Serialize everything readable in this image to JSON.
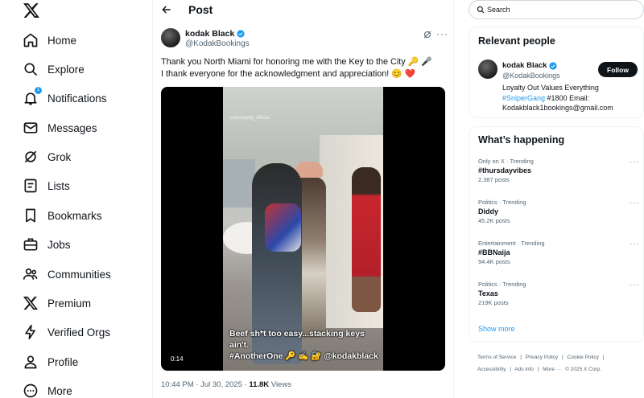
{
  "nav": {
    "items": [
      {
        "label": "Home",
        "icon": "home-icon"
      },
      {
        "label": "Explore",
        "icon": "search-icon"
      },
      {
        "label": "Notifications",
        "icon": "bell-icon",
        "badge": "1"
      },
      {
        "label": "Messages",
        "icon": "mail-icon"
      },
      {
        "label": "Grok",
        "icon": "grok-icon"
      },
      {
        "label": "Lists",
        "icon": "list-icon"
      },
      {
        "label": "Bookmarks",
        "icon": "bookmark-icon"
      },
      {
        "label": "Jobs",
        "icon": "briefcase-icon"
      },
      {
        "label": "Communities",
        "icon": "people-icon"
      },
      {
        "label": "Premium",
        "icon": "x-logo-icon"
      },
      {
        "label": "Verified Orgs",
        "icon": "lightning-icon"
      },
      {
        "label": "Profile",
        "icon": "person-icon"
      },
      {
        "label": "More",
        "icon": "more-circle-icon"
      }
    ]
  },
  "header": {
    "title": "Post"
  },
  "tweet": {
    "author_name": "kodak Black",
    "author_handle": "@KodakBookings",
    "text_line1": "Thank you North Miami for honoring me with the Key to the City 🔑 🎤",
    "text_line2": "I thank everyone  for the acknowledgment and appreciation! 😊 ❤️",
    "video": {
      "watermark": "snipergang_official",
      "caption_line1": "Beef sh*t too easy...stacking keys ain't.",
      "caption_line2": "#AnotherOne 🔑 ✍️ 🔐 @kodakblack",
      "duration": "0:14"
    },
    "time": "10:44 PM · Jul 30, 2025 · ",
    "views_count": "11.8K",
    "views_label": " Views"
  },
  "search": {
    "placeholder": "Search"
  },
  "relevant": {
    "title": "Relevant people",
    "name": "kodak Black",
    "handle": "@KodakBookings",
    "follow_label": "Follow",
    "bio_line1": "Loyalty Out Values Everything",
    "bio_hashtag": "#SniperGang",
    "bio_rest": " #1800 Email:",
    "bio_line3": "Kodakblack1bookings@gmail.com"
  },
  "happening": {
    "title": "What’s happening",
    "trends": [
      {
        "category": "Only on X · Trending",
        "name": "#thursdayvibes",
        "posts": "2,387 posts"
      },
      {
        "category": "Politics · Trending",
        "name": "Diddy",
        "posts": "45.2K posts"
      },
      {
        "category": "Entertainment · Trending",
        "name": "#BBNaija",
        "posts": "94.4K posts"
      },
      {
        "category": "Politics · Trending",
        "name": "Texas",
        "posts": "219K posts"
      }
    ],
    "show_more": "Show more"
  },
  "footer": {
    "terms": "Terms of Service",
    "privacy": "Privacy Policy",
    "cookie": "Cookie Policy",
    "accessibility": "Accessibility",
    "ads": "Ads info",
    "more": "More ···",
    "copyright": "© 2025 X Corp.",
    "sep": "|"
  },
  "colors": {
    "accent": "#1d9bf0",
    "text": "#0f1419",
    "muted": "#536471",
    "border": "#eff3f4"
  }
}
